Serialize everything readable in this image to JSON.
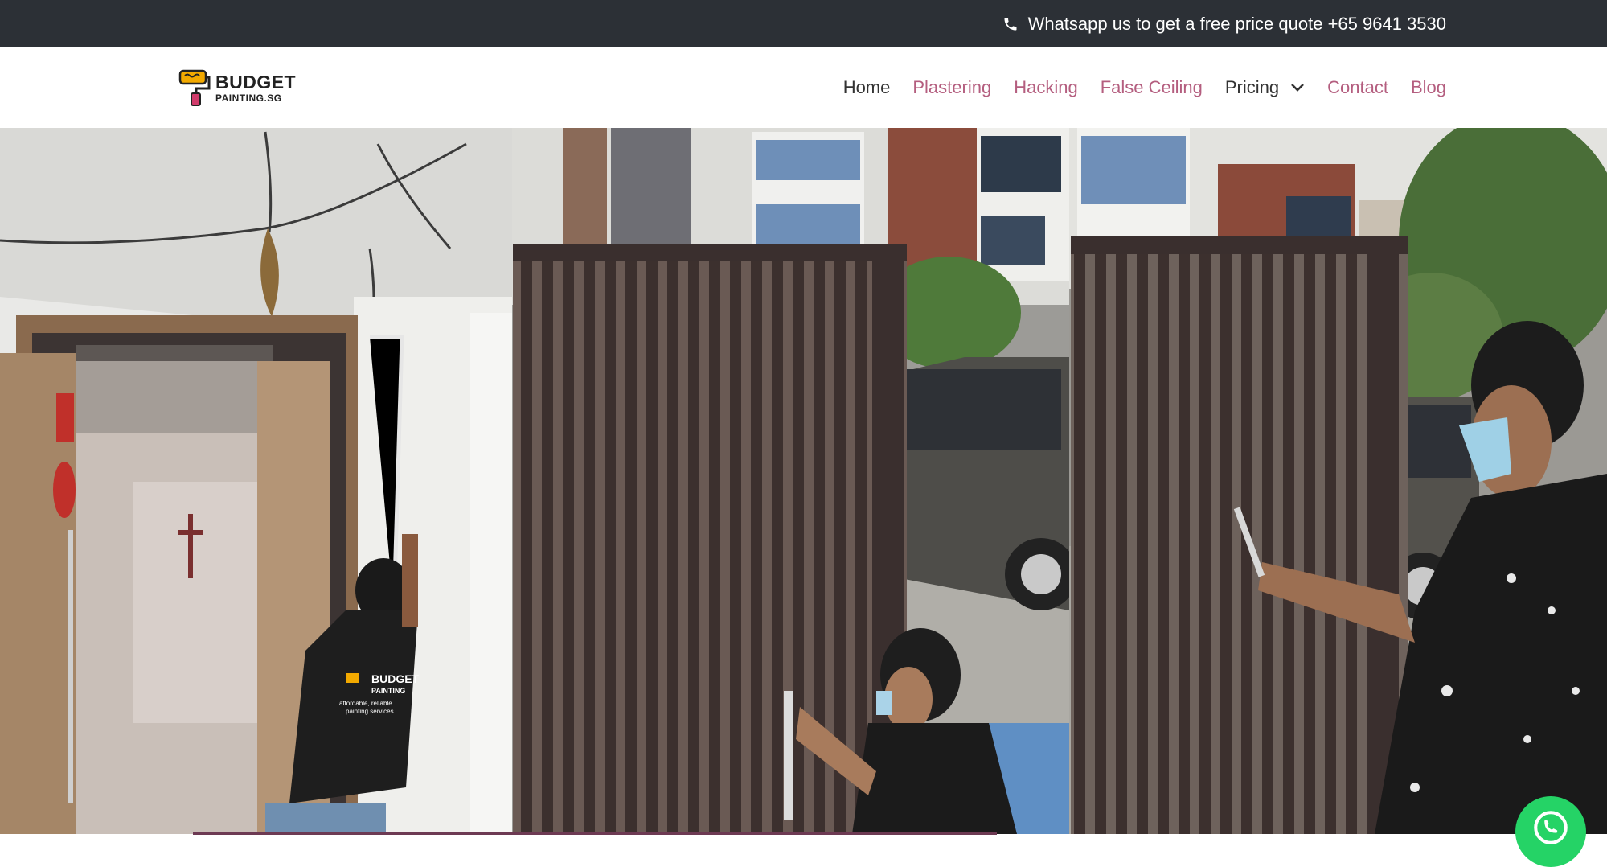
{
  "topbar": {
    "icon": "phone-icon",
    "text": "Whatsapp us to get a free price quote +65 9641 3530"
  },
  "brand": {
    "logo_line1": "BUDGET",
    "logo_line2": "PAINTING.SG",
    "accent": "#b45e7f"
  },
  "nav": {
    "items": [
      {
        "label": "Home"
      },
      {
        "label": "Plastering"
      },
      {
        "label": "Hacking"
      },
      {
        "label": "False Ceiling"
      },
      {
        "label": "Pricing"
      },
      {
        "label": "Contact"
      },
      {
        "label": "Blog"
      }
    ]
  },
  "hero": {
    "shirt_line1": "BUDGET",
    "shirt_line2": "PAINTING",
    "shirt_line3": "affordable, reliable",
    "shirt_line4": "painting services"
  },
  "floating": {
    "icon": "whatsapp-icon",
    "color": "#25d366"
  }
}
